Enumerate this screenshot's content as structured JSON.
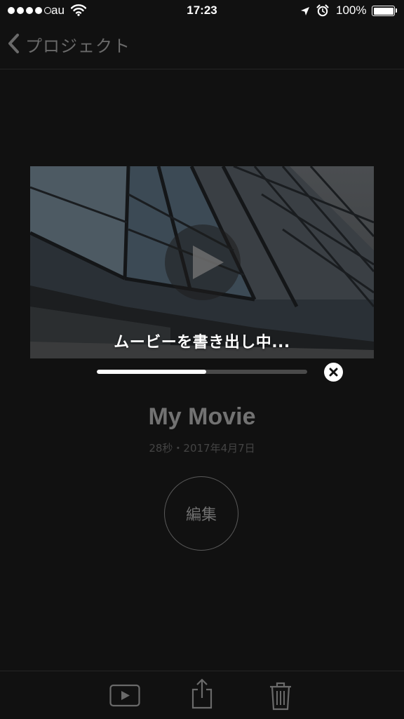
{
  "status_bar": {
    "carrier": "au",
    "time": "17:23",
    "battery": "100%",
    "signal_bars_filled": 4,
    "signal_bars_total": 5,
    "icons": [
      "wifi-icon",
      "location-arrow-icon",
      "alarm-clock-icon",
      "battery-icon"
    ]
  },
  "nav": {
    "back_label": "プロジェクト",
    "back_icon": "chevron-left-icon"
  },
  "preview": {
    "export_label": "ムービーを書き出し中...",
    "play_icon": "play-icon"
  },
  "export": {
    "progress": 0.52,
    "cancel_icon": "close-icon"
  },
  "movie": {
    "title": "My Movie",
    "meta": "28秒・2017年4月7日",
    "edit_label": "編集"
  },
  "toolbar": {
    "icons": [
      "play-movie-icon",
      "share-icon",
      "trash-icon"
    ]
  },
  "colors": {
    "background": "#111111",
    "dim_text": "#727272",
    "meta_text": "#444444"
  }
}
